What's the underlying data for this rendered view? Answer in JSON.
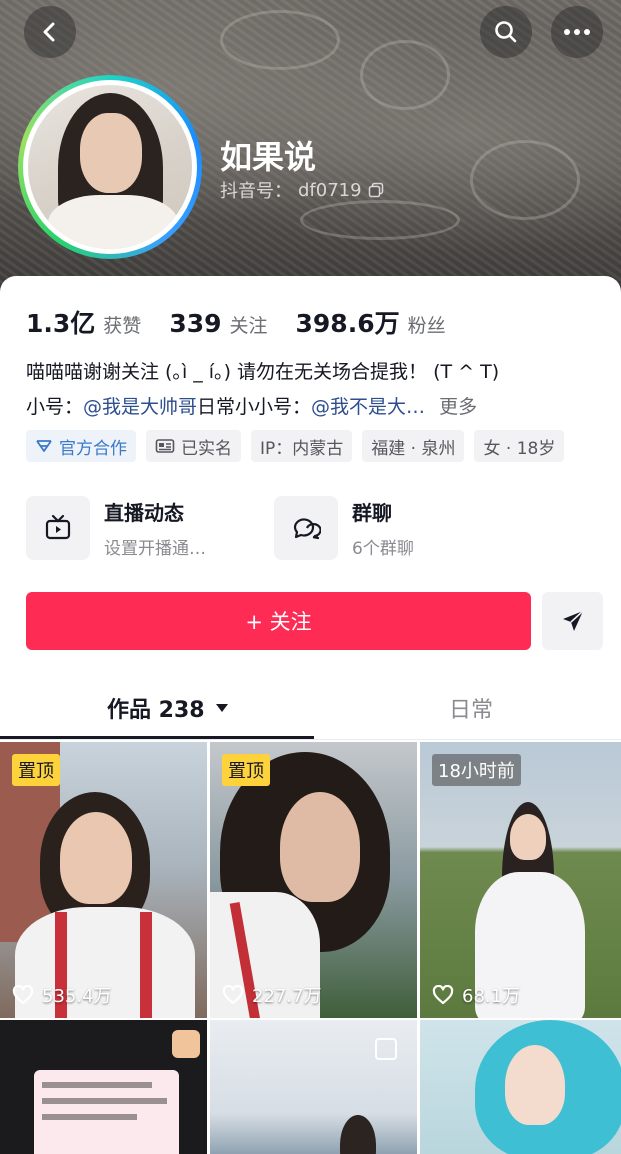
{
  "header": {
    "nickname": "如果说",
    "douyin_id_label": "抖音号：",
    "douyin_id": "df0719"
  },
  "stats": [
    {
      "value": "1.3亿",
      "label": "获赞"
    },
    {
      "value": "339",
      "label": "关注"
    },
    {
      "value": "398.6万",
      "label": "粉丝"
    }
  ],
  "bio": {
    "line1": "喵喵喵谢谢关注 (｡ì _ í｡) 请勿在无关场合提我！ (T ^ T)",
    "small_account_label": "小号：",
    "small_account": "@我是大帅哥",
    "daily_account_label": " 日常小小号：",
    "daily_account": "@我不是大…",
    "more": "更多"
  },
  "tags": [
    {
      "icon": "official-cooperation-icon",
      "text": "官方合作"
    },
    {
      "icon": "id-card-icon",
      "text": "已实名"
    },
    {
      "icon": "",
      "text": "IP：内蒙古"
    },
    {
      "icon": "",
      "text": "福建 · 泉州"
    },
    {
      "icon": "",
      "text": "女 · 18岁"
    }
  ],
  "features": {
    "live": {
      "title": "直播动态",
      "subtitle": "设置开播通…",
      "icon": "tv-icon"
    },
    "group": {
      "title": "群聊",
      "subtitle": "6个群聊",
      "icon": "chat-bubbles-icon"
    }
  },
  "actions": {
    "follow_label": "+ 关注",
    "dm_icon": "paper-plane-icon"
  },
  "tabs": {
    "works_label": "作品 238",
    "daily_label": "日常"
  },
  "videos": [
    {
      "badge": "置顶",
      "likes": "535.4万"
    },
    {
      "badge": "置顶",
      "likes": "227.7万"
    },
    {
      "badge": "18小时前",
      "likes": "68.1万"
    },
    {
      "badge": "",
      "likes": ""
    },
    {
      "badge": "",
      "likes": ""
    },
    {
      "badge": "",
      "likes": ""
    }
  ],
  "colors": {
    "follow": "#fe2c55",
    "pin_badge": "#fdd23b",
    "mention": "#2e4e8f"
  }
}
